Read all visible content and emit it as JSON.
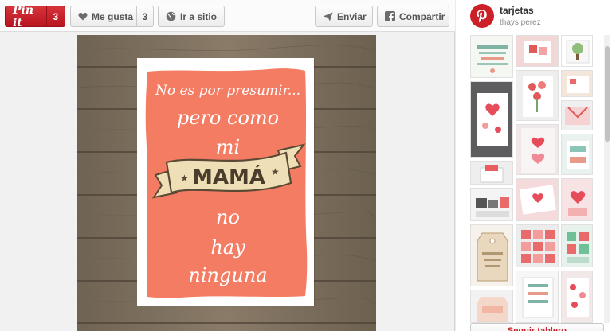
{
  "toolbar": {
    "pinit_label": "Pin it",
    "pinit_count": "3",
    "like_label": "Me gusta",
    "like_count": "3",
    "visit_label": "Ir a sitio",
    "send_label": "Enviar",
    "share_label": "Compartir"
  },
  "pin": {
    "card_lines": [
      "No es por presumir...",
      "pero como",
      "mi",
      "MAMÁ",
      "no",
      "hay",
      "ninguna"
    ],
    "card_color": "#f47c63",
    "banner_color": "#efdfb6"
  },
  "board": {
    "title": "tarjetas",
    "owner": "thays perez",
    "follow_label": "Seguir tablero"
  },
  "colors": {
    "accent": "#cb2027"
  }
}
